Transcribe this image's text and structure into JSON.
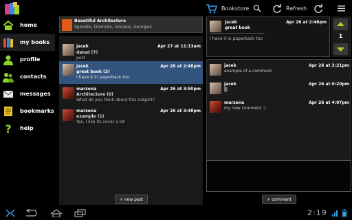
{
  "toolbar": {
    "bookstore_label": "Bookstore",
    "refresh_label": "Refresh"
  },
  "sidebar": {
    "items": [
      {
        "label": "home",
        "icon": "home-icon"
      },
      {
        "label": "my books",
        "icon": "books-icon"
      },
      {
        "label": "profile",
        "icon": "profile-icon"
      },
      {
        "label": "contacts",
        "icon": "contacts-icon"
      },
      {
        "label": "messages",
        "icon": "envelope-icon"
      },
      {
        "label": "bookmarks",
        "icon": "bookmarks-icon"
      },
      {
        "label": "help",
        "icon": "question-icon"
      }
    ],
    "active_index": 1
  },
  "book": {
    "title": "Beautiful Architecture",
    "authors": "Spinellis, Diomidis, Gousios, Georgios"
  },
  "posts": [
    {
      "author": "jacek",
      "date": "Apr 27 at 11:13am",
      "title": "dated (7)",
      "body": "post"
    },
    {
      "author": "jacek",
      "date": "Apr 26 at 2:48pm",
      "title": "great book (3)",
      "body": "I have it in paperback too"
    },
    {
      "author": "marzena",
      "date": "Apr 26 at 3:50pm",
      "title": "Architecture (0)",
      "body": "What do you think about this subject?"
    },
    {
      "author": "marzena",
      "date": "Apr 26 at 3:48pm",
      "title": "example (1)",
      "body": "Yes, I like its cover a lot"
    }
  ],
  "new_post_label": "+ new post",
  "detail": {
    "author": "jacek",
    "date": "Apr 26 at 2:48pm",
    "title": "great book",
    "body": "I have it in paperback too"
  },
  "pager": {
    "page": "1"
  },
  "comments": [
    {
      "author": "jacek",
      "date": "Apr 26 at 3:21pm",
      "body": "example of a comment"
    },
    {
      "author": "jacek",
      "date": "Apr 26 at 0:20pm",
      "body": "▒"
    },
    {
      "author": "marzena",
      "date": "Apr 26 at 4:07pm",
      "body": "my new comment :)"
    }
  ],
  "add_comment_label": "+ comment",
  "status": {
    "clock": "2:19"
  },
  "colors": {
    "selected": "#33547e",
    "accent_green": "#a8d420"
  }
}
